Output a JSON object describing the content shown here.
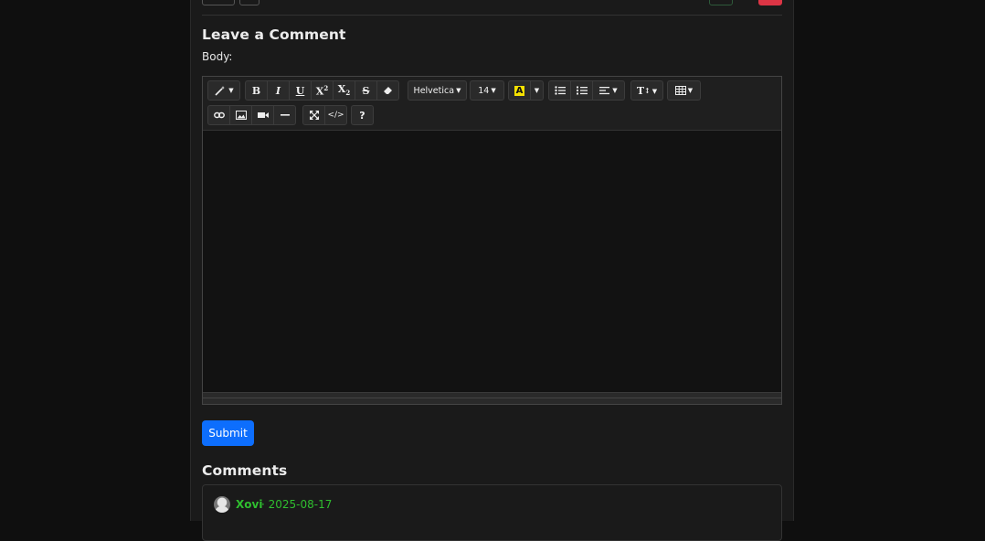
{
  "form": {
    "heading": "Leave a Comment",
    "body_label": "Body:",
    "submit_label": "Submit"
  },
  "toolbar": {
    "font_name": "Helvetica",
    "font_size": "14",
    "highlight_letter": "A",
    "style_label": "T",
    "help_label": "?",
    "code_label": "</>"
  },
  "comments": {
    "heading": "Comments",
    "items": [
      {
        "user": "Xovi",
        "date": "· 2025-08-17",
        "text": ""
      }
    ]
  },
  "colors": {
    "accent": "#0d6efd",
    "username": "#2fbf2f",
    "highlight": "#f5e100",
    "danger": "#dc3545"
  }
}
